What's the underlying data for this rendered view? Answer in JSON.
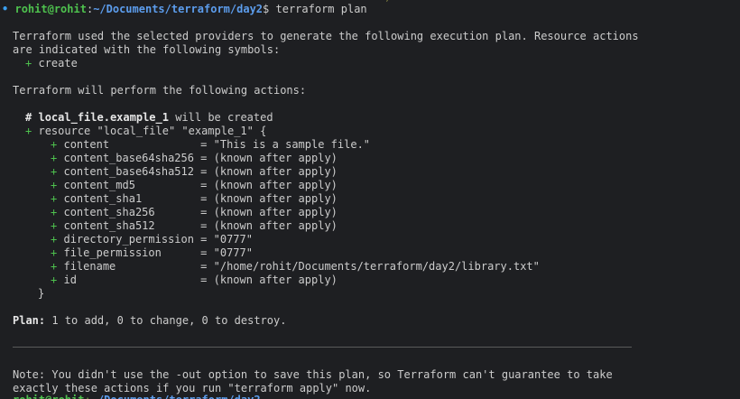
{
  "prompt": {
    "user_host": "rohit@rohit",
    "path": "~/Documents/terraform/day2",
    "symbol": "$",
    "command": "terraform plan",
    "top_fragment": ")"
  },
  "intro": {
    "line1": "Terraform used the selected providers to generate the following execution plan. Resource actions",
    "line2": "are indicated with the following symbols:",
    "legend_symbol": "+",
    "legend_text": "create"
  },
  "actions_header": "Terraform will perform the following actions:",
  "resource": {
    "comment_hash": "#",
    "address": "local_file.example_1",
    "status": "will be created",
    "plus": "+",
    "declaration": "resource \"local_file\" \"example_1\" {",
    "attributes": [
      {
        "line": "content              = \"This is a sample file.\""
      },
      {
        "line": "content_base64sha256 = (known after apply)"
      },
      {
        "line": "content_base64sha512 = (known after apply)"
      },
      {
        "line": "content_md5          = (known after apply)"
      },
      {
        "line": "content_sha1         = (known after apply)"
      },
      {
        "line": "content_sha256       = (known after apply)"
      },
      {
        "line": "content_sha512       = (known after apply)"
      },
      {
        "line": "directory_permission = \"0777\""
      },
      {
        "line": "file_permission      = \"0777\""
      },
      {
        "line": "filename             = \"/home/rohit/Documents/terraform/day2/library.txt\""
      },
      {
        "line": "id                   = (known after apply)"
      }
    ],
    "closing": "}"
  },
  "plan": {
    "label": "Plan:",
    "summary": "1 to add, 0 to change, 0 to destroy."
  },
  "note": {
    "line1": "Note: You didn't use the -out option to save this plan, so Terraform can't guarantee to take",
    "line2": "exactly these actions if you run \"terraform apply\" now."
  },
  "colors": {
    "background": "#1e1f22",
    "text": "#cccccc",
    "plus": "#4ec24e",
    "path": "#5c9ded"
  }
}
